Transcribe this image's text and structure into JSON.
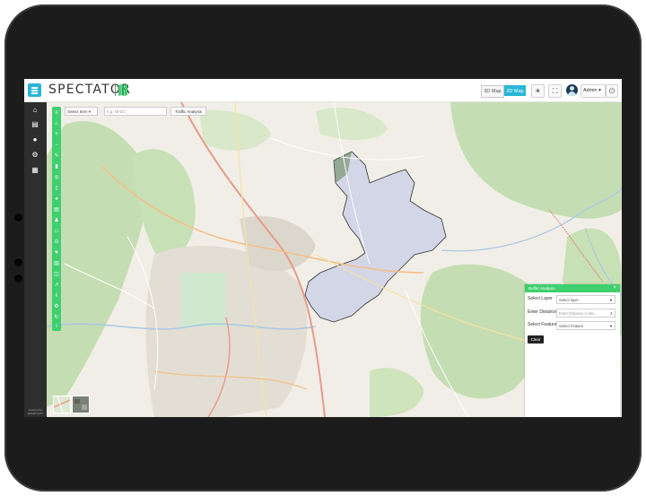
{
  "app": {
    "name": "SPECTATOR"
  },
  "header": {
    "view_3d": "3D Map",
    "view_2d": "2D Map",
    "user_label": "Admin"
  },
  "sidebar": {
    "items": [
      {
        "icon": "home-icon"
      },
      {
        "icon": "report-icon"
      },
      {
        "icon": "info-icon"
      },
      {
        "icon": "settings-icon"
      },
      {
        "icon": "analytics-icon"
      }
    ],
    "footer": "Powered by SMARTICITY"
  },
  "map_toolbar": {
    "select_item": "Select Item",
    "search_placeholder": "e.g. NFDC",
    "traffic_analysis": "Traffic Analysis"
  },
  "buffer_analysis": {
    "title": "Buffer Analysis",
    "select_layer_label": "Select Layer",
    "select_layer_value": "Select layer",
    "distance_label": "Enter Distance",
    "distance_placeholder": "Enter Distance in Me...",
    "feature_label": "Select Feature",
    "feature_value": "Select Feature",
    "clear_button": "Clear"
  },
  "colors": {
    "accent_blue": "#29b6d8",
    "toolbar_green": "#3ecf6e",
    "sidebar_dark": "#2e2e2e",
    "boundary_fill": "#c7cde6"
  }
}
